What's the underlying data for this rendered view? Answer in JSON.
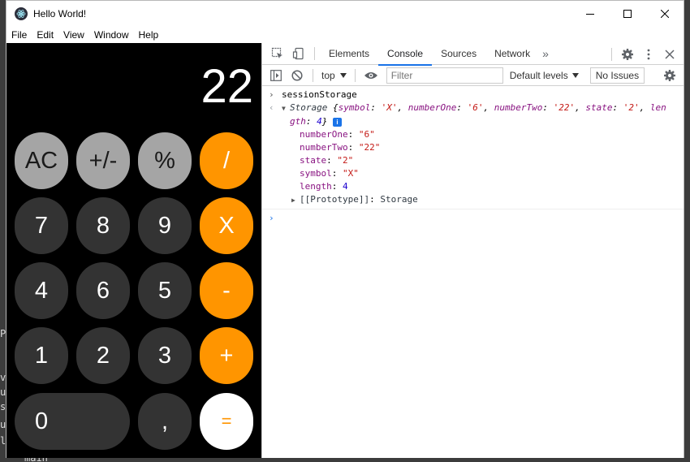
{
  "window": {
    "title": "Hello World!"
  },
  "menu": [
    "File",
    "Edit",
    "View",
    "Window",
    "Help"
  ],
  "calculator": {
    "display": "22",
    "keys": [
      {
        "label": "AC",
        "style": "gray"
      },
      {
        "label": "+/-",
        "style": "gray"
      },
      {
        "label": "%",
        "style": "gray"
      },
      {
        "label": "/",
        "style": "orange"
      },
      {
        "label": "7",
        "style": "dark"
      },
      {
        "label": "8",
        "style": "dark"
      },
      {
        "label": "9",
        "style": "dark"
      },
      {
        "label": "X",
        "style": "orange"
      },
      {
        "label": "4",
        "style": "dark"
      },
      {
        "label": "6",
        "style": "dark"
      },
      {
        "label": "5",
        "style": "dark"
      },
      {
        "label": "-",
        "style": "orange"
      },
      {
        "label": "1",
        "style": "dark"
      },
      {
        "label": "2",
        "style": "dark"
      },
      {
        "label": "3",
        "style": "dark"
      },
      {
        "label": "+",
        "style": "orange"
      },
      {
        "label": "0",
        "style": "dark"
      },
      {
        "label": ",",
        "style": "dark"
      },
      {
        "label": "=",
        "style": "white"
      }
    ],
    "colors": {
      "operator": "#ff9500",
      "function": "#a5a5a5",
      "digit": "#333333"
    }
  },
  "devtools": {
    "tabs": [
      "Elements",
      "Console",
      "Sources",
      "Network"
    ],
    "active_tab": "Console",
    "more_tabs": "»",
    "context": "top",
    "filter_placeholder": "Filter",
    "levels": "Default levels",
    "issues": "No Issues",
    "console": {
      "command": "sessionStorage",
      "summary_name": "Storage",
      "summary_open": " {",
      "summary": [
        {
          "k": "symbol",
          "v": "'X'"
        },
        {
          "k": "numberOne",
          "v": "'6'"
        },
        {
          "k": "numberTwo",
          "v": "'22'"
        },
        {
          "k": "state",
          "v": "'2'"
        }
      ],
      "summary_length_key": "len",
      "summary_length_key2": "gth",
      "summary_length_val": "4",
      "summary_close": "}",
      "properties": [
        {
          "k": "numberOne",
          "v": "\"6\"",
          "type": "str"
        },
        {
          "k": "numberTwo",
          "v": "\"22\"",
          "type": "str"
        },
        {
          "k": "state",
          "v": "\"2\"",
          "type": "str"
        },
        {
          "k": "symbol",
          "v": "\"X\"",
          "type": "str"
        },
        {
          "k": "length",
          "v": "4",
          "type": "num"
        }
      ],
      "prototype_key": "[[Prototype]]",
      "prototype_val": "Storage"
    }
  },
  "background_text": [
    "P",
    "va",
    "uc",
    "sh",
    "uc",
    "le",
    "main"
  ]
}
